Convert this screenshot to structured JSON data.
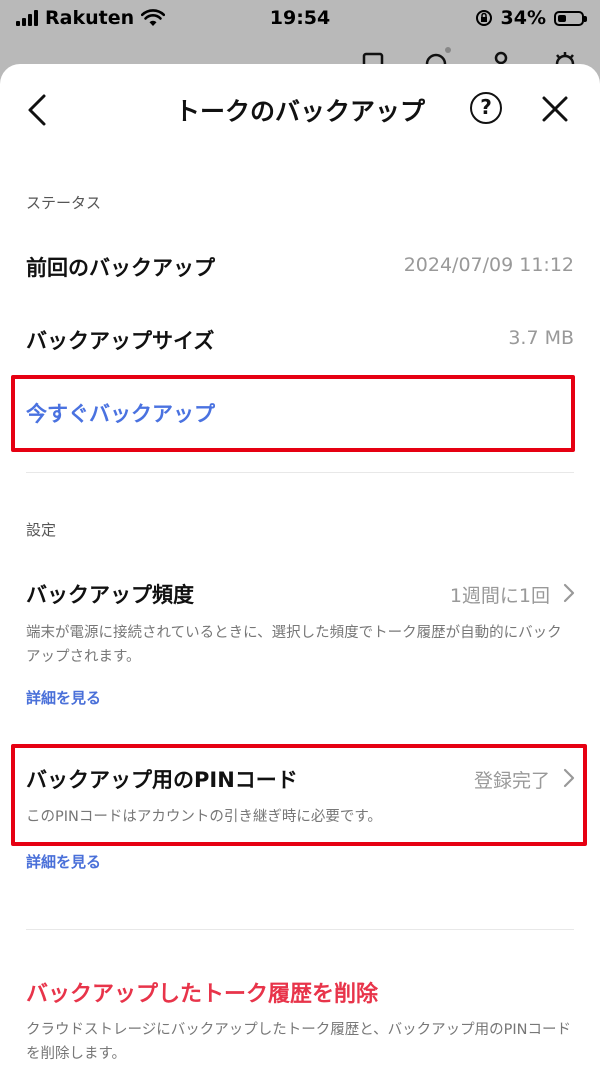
{
  "status_bar": {
    "carrier": "Rakuten",
    "time": "19:54",
    "battery": "34%",
    "battery_level": 0.34
  },
  "header": {
    "title": "トークのバックアップ",
    "help_label": "?"
  },
  "status_section": {
    "label": "ステータス",
    "last_backup_label": "前回のバックアップ",
    "last_backup_value": "2024/07/09 11:12",
    "size_label": "バックアップサイズ",
    "size_value": "3.7 MB",
    "backup_now": "今すぐバックアップ"
  },
  "settings_section": {
    "label": "設定",
    "frequency_label": "バックアップ頻度",
    "frequency_value": "1週間に1回",
    "frequency_desc": "端末が電源に接続されているときに、選択した頻度でトーク履歴が自動的にバックアップされます。",
    "frequency_link": "詳細を見る",
    "pin_label": "バックアップ用のPINコード",
    "pin_value": "登録完了",
    "pin_desc": "このPINコードはアカウントの引き継ぎ時に必要です。",
    "pin_link": "詳細を見る"
  },
  "delete_section": {
    "delete_label": "バックアップしたトーク履歴を削除",
    "delete_desc": "クラウドストレージにバックアップしたトーク履歴と、バックアップ用のPINコードを削除します。"
  },
  "colors": {
    "link_blue": "#4a70d9",
    "danger_red": "#e8344a",
    "highlight_red": "#e60012"
  }
}
